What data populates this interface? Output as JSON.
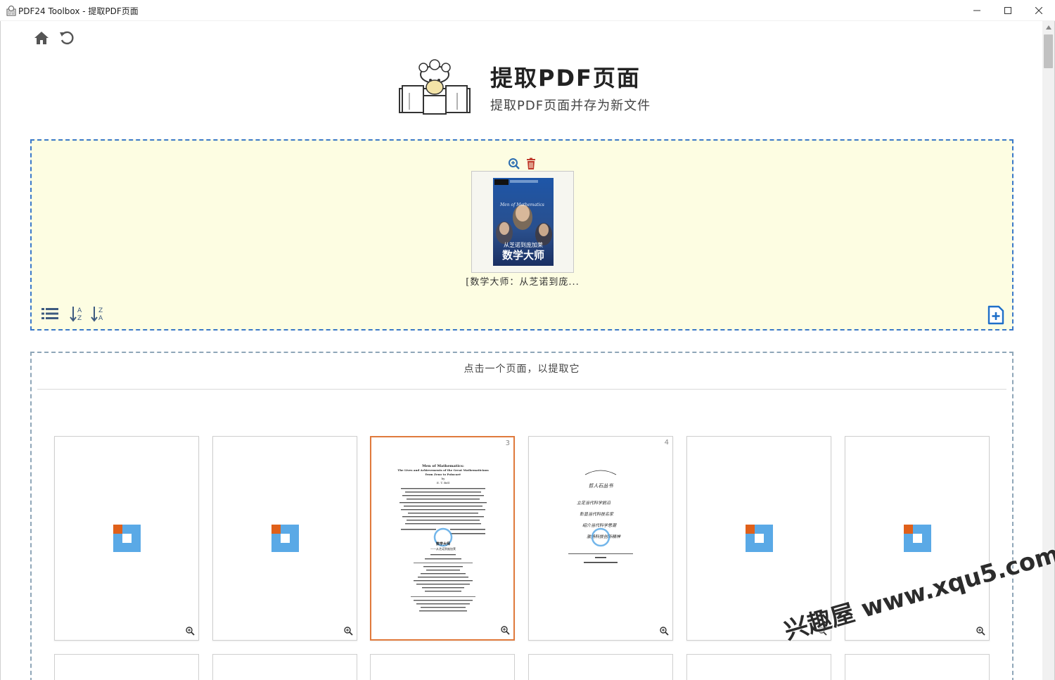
{
  "window": {
    "title": "PDF24 Toolbox - 提取PDF页面",
    "icon": "pdf24-chef-icon"
  },
  "header": {
    "title": "提取PDF页面",
    "subtitle": "提取PDF页面并存为新文件"
  },
  "file_zone": {
    "file_name": "[数学大师：从芝诺到庞...",
    "book_cover": {
      "title": "数学大师",
      "subtitle": "从芝诺到庞加莱",
      "english_title": "Men of Mathematics"
    },
    "background_color": "#fdfde2",
    "border_color": "#3a78c8"
  },
  "pages_zone": {
    "hint": "点击一个页面，以提取它",
    "pages": [
      {
        "number": "",
        "state": "loading",
        "selected": false
      },
      {
        "number": "",
        "state": "loading",
        "selected": false
      },
      {
        "number": "3",
        "state": "rendered",
        "selected": true
      },
      {
        "number": "4",
        "state": "rendered",
        "selected": false
      },
      {
        "number": "",
        "state": "loading",
        "selected": false
      },
      {
        "number": "",
        "state": "loading",
        "selected": false
      }
    ],
    "page3_text": {
      "line1": "Men of Mathematics:",
      "line2": "The Lives and Achievements of the Great Mathematicians",
      "line3": "from Zeno to Poincaré",
      "line4": "by",
      "line5": "E. T. Bell",
      "cn_title": "数学大师",
      "cn_sub": "——从芝诺到庞加莱"
    },
    "page4_text": {
      "brand": "哲人石丛书",
      "l1": "立足当代科学前沿",
      "l2": "彰显当代科技名家",
      "l3": "绍介当代科学思潮",
      "l4": "激扬科技创新精神"
    },
    "selected_color": "#e07a3c"
  },
  "watermark": "兴趣屋 www.xqu5.com",
  "colors": {
    "accent": "#3a78c8",
    "delete": "#c0392b",
    "placeholder_orange": "#e0601a",
    "placeholder_blue": "#5aa9e6"
  }
}
